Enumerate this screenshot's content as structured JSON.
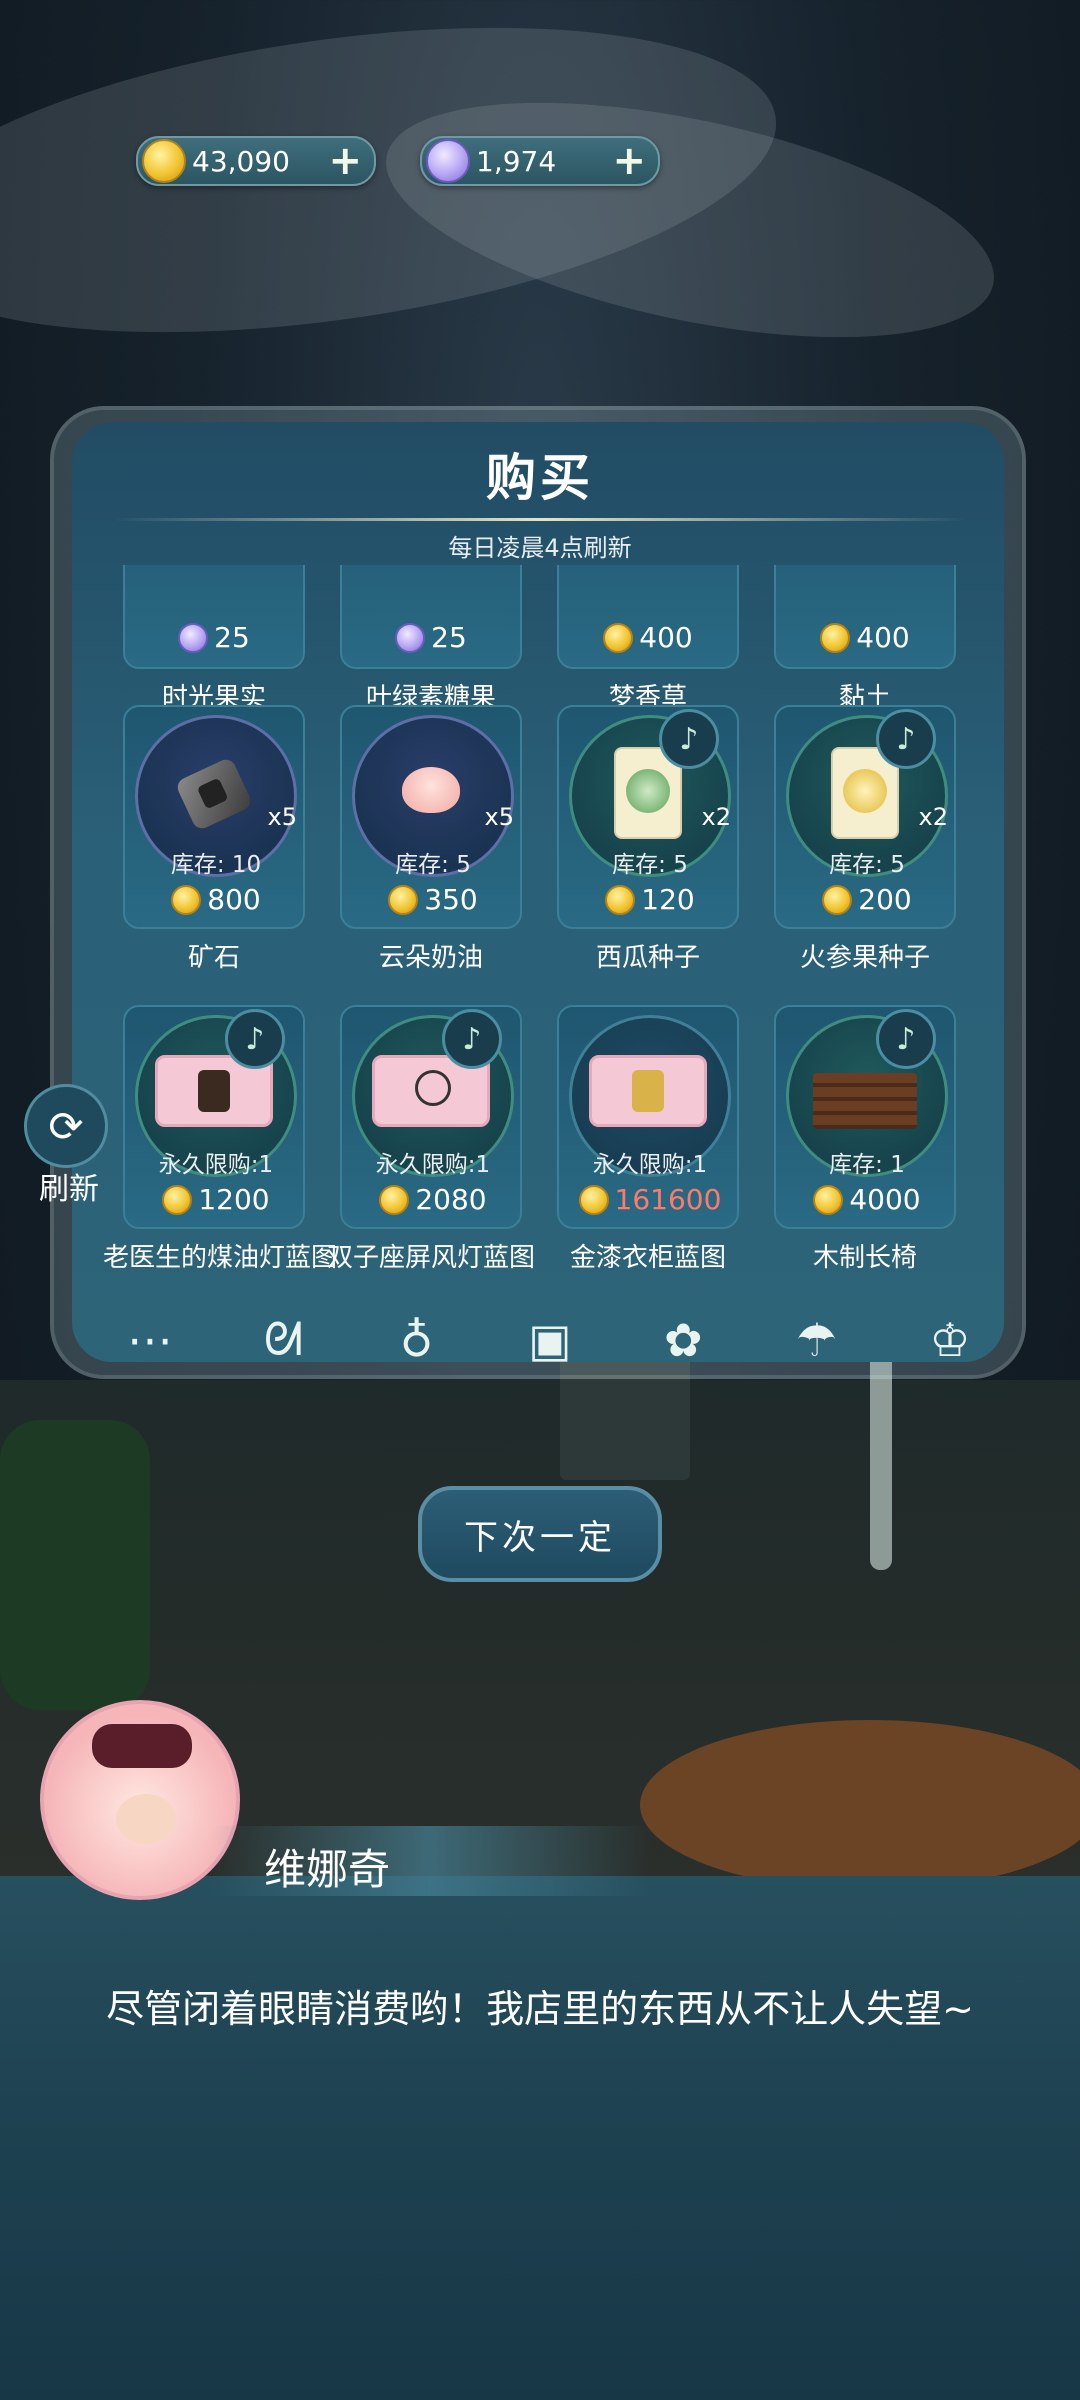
{
  "currencies": {
    "gold": {
      "value": "43,090",
      "icon": "gold-coin-icon"
    },
    "moon": {
      "value": "1,974",
      "icon": "moon-coin-icon"
    }
  },
  "shop": {
    "title": "购买",
    "subtitle": "每日凌晨4点刷新",
    "rows": [
      [
        {
          "name": "时光果实",
          "price": "25",
          "currency": "moon"
        },
        {
          "name": "叶绿素糖果",
          "price": "25",
          "currency": "moon"
        },
        {
          "name": "梦香草",
          "price": "400",
          "currency": "gold"
        },
        {
          "name": "黏土",
          "price": "400",
          "currency": "gold"
        }
      ],
      [
        {
          "name": "矿石",
          "stock": "库存: 10",
          "qty": "x5",
          "price": "800",
          "currency": "gold",
          "art": "ore"
        },
        {
          "name": "云朵奶油",
          "stock": "库存: 5",
          "qty": "x5",
          "price": "350",
          "currency": "gold",
          "art": "cream"
        },
        {
          "name": "西瓜种子",
          "stock": "库存: 5",
          "qty": "x2",
          "price": "120",
          "currency": "gold",
          "art": "seed-watermelon"
        },
        {
          "name": "火参果种子",
          "stock": "库存: 5",
          "qty": "x2",
          "price": "200",
          "currency": "gold",
          "art": "seed-kiwano"
        }
      ],
      [
        {
          "name": "老医生的煤油灯蓝图",
          "stock": "永久限购:1",
          "price": "1200",
          "currency": "gold",
          "art": "blueprint-lamp"
        },
        {
          "name": "双子座屏风灯蓝图",
          "stock": "永久限购:1",
          "price": "2080",
          "currency": "gold",
          "art": "blueprint-screen"
        },
        {
          "name": "金漆衣柜蓝图",
          "stock": "永久限购:1",
          "price": "161600",
          "currency": "gold",
          "price_color": "#ff7a6a",
          "art": "blueprint-wardrobe"
        },
        {
          "name": "木制长椅",
          "stock": "库存: 1",
          "price": "4000",
          "currency": "gold",
          "art": "bench"
        }
      ]
    ]
  },
  "refresh": {
    "label": "刷新"
  },
  "categories": [
    "more-icon",
    "cat-face-icon",
    "bag-icon",
    "box-icon",
    "flower-icon",
    "umbrella-icon",
    "clothes-icon"
  ],
  "next_button": "下次一定",
  "dialog": {
    "speaker": "维娜奇",
    "text": "尽管闭着眼睛消费哟！我店里的东西从不让人失望~"
  }
}
